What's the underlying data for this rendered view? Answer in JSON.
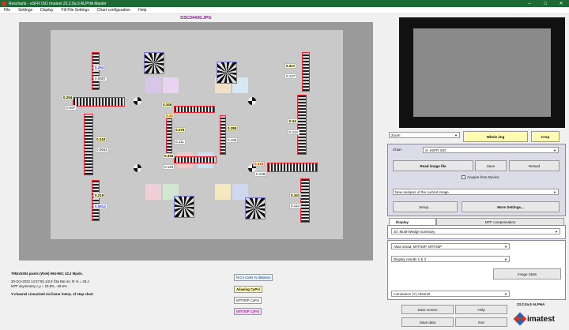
{
  "titlebar": {
    "title": "Rescharts - eSFR ISO Imatest 23.2.0a.5 ALPHA Master"
  },
  "menu": [
    "File",
    "Settings",
    "Display",
    "Fill File Settings",
    "Chart configuration",
    "Help"
  ],
  "image": {
    "filename": "DSC04436.JPG",
    "labels": {
      "l1": "0.294",
      "l1b": "0.0807",
      "l2": "0.317",
      "l2b": "0.137",
      "l3": "0.294",
      "l3b": "0.097",
      "l4": "0.346",
      "l5": "0.14",
      "l6": "0.276",
      "l6b": "0.111",
      "l7": "0.288",
      "l7b": "0.106",
      "l8": "0.34",
      "l8b": "0.112",
      "l9": "0.243",
      "l9b": "0.0944",
      "l10": "0.335",
      "l10b": "0.129",
      "l11": "0.418",
      "l11b": "0.108",
      "l12": "0.218",
      "l12b": "0.0814",
      "l13": "0.341",
      "l13b": "0.113"
    }
  },
  "info": {
    "line1": "7952x5304 pixels (WxH) 994-963;   42.2 Mpxls.",
    "line2": "30-Oct-2023 14:37:55   1/2.8 f/3a    Bar ax: ht % = 28.4",
    "line3": "MTF asymmetry c,y = 23.8%, -49.5%",
    "line4": "Y-channel    Linearized via linear interp. of step chart"
  },
  "legend": {
    "l1": "N  CA coins % distance",
    "l2": "Aliasing CyPxl",
    "l3": "MTF50P  CyPxl",
    "l4": "MTF30P  CyPxl"
  },
  "controls": {
    "zoom": "Zoom",
    "whole_img": "Whole img",
    "crop": "Crop",
    "chart_label": "Chart",
    "chart_value": "S- eSFR ISO",
    "read_image": "Read image file",
    "save": "Save",
    "reload": "Reload",
    "acquire": "Acquire from Device",
    "analysis": "New analysis of the current image",
    "setup": "Setup...",
    "more_settings": "More Settings...",
    "tab_display": "Display",
    "tab_mtf": "MTF compensation",
    "display_select": "20. Multi-Wedge summary",
    "alias_select": "Alias sread, MTF50P, MTF20P",
    "display_results": "Display results 2 & 3",
    "image_stats": "Image Stats",
    "channel": "Luminance (Y) channel",
    "save_screen": "Save screen",
    "help": "Help",
    "save_data": "Save data",
    "exit": "Exit"
  },
  "brand": {
    "version": "23.2.0a.5 ALPHA",
    "name": "imatest"
  }
}
